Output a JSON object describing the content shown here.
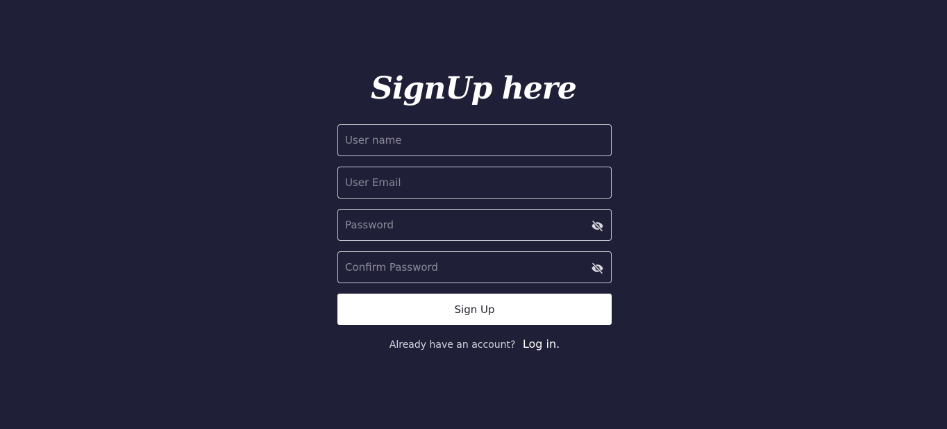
{
  "page": {
    "title": "SignUp here"
  },
  "form": {
    "username_placeholder": "User name",
    "email_placeholder": "User Email",
    "password_placeholder": "Password",
    "confirm_password_placeholder": "Confirm Password",
    "submit_label": "Sign Up"
  },
  "footer": {
    "prompt": "Already have an account?",
    "login_label": "Log in."
  },
  "icons": {
    "password_toggle": "eye-slash-icon",
    "confirm_password_toggle": "eye-slash-icon"
  },
  "colors": {
    "background": "#201f38",
    "button": "#ffffff",
    "text": "#ffffff"
  }
}
